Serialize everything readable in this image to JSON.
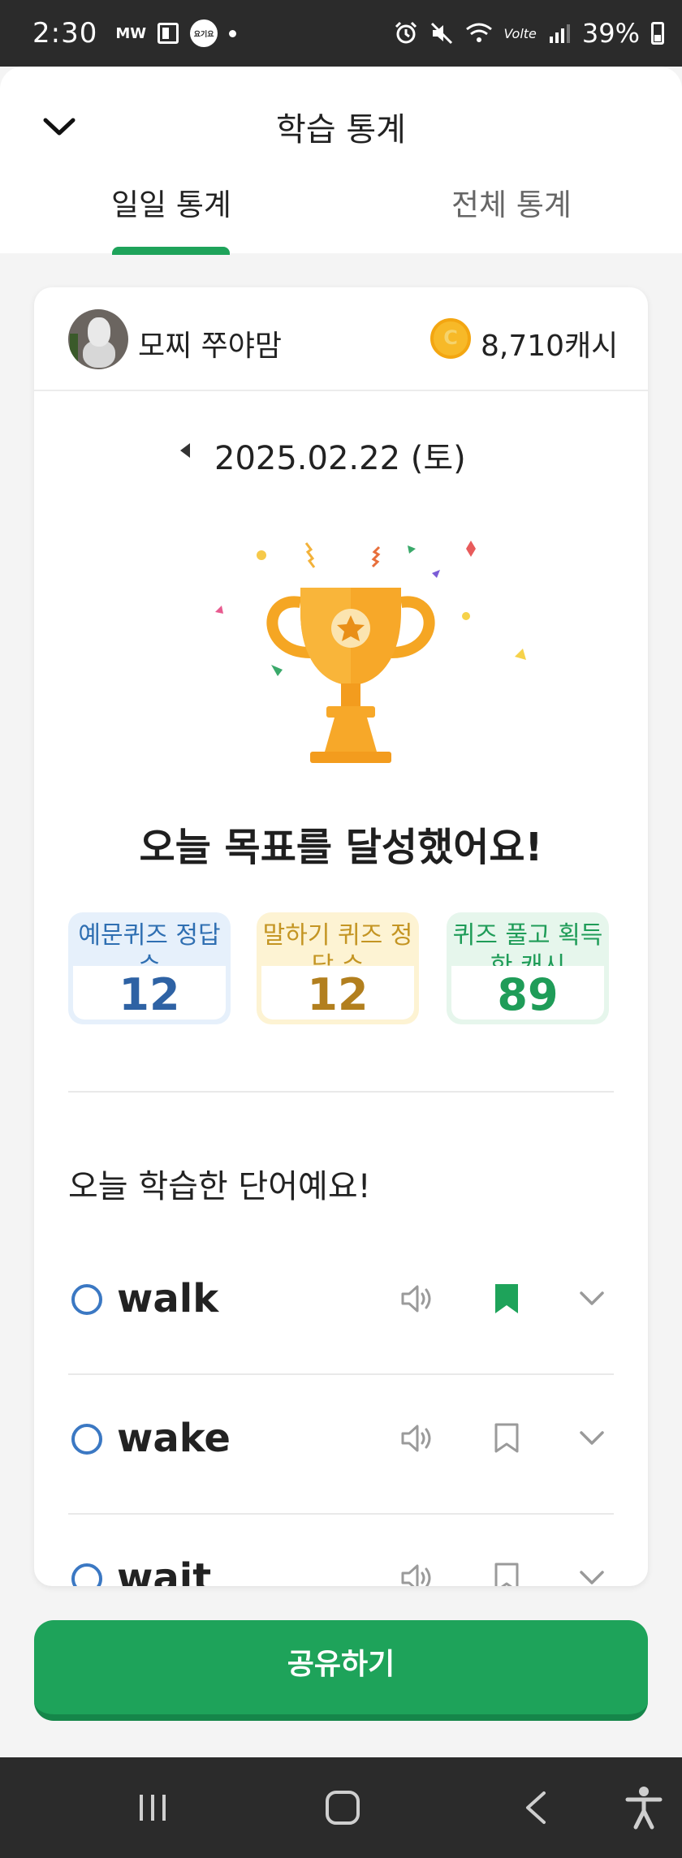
{
  "status_bar": {
    "time": "2:30",
    "mw": "MW",
    "yogiyo": "요기요",
    "volte": "Volte",
    "battery": "39%"
  },
  "header": {
    "title": "학습 통계",
    "tabs": [
      {
        "label": "일일 통계",
        "active": true
      },
      {
        "label": "전체 통계",
        "active": false
      }
    ]
  },
  "profile": {
    "name": "모찌 쭈야맘",
    "cash": "8,710캐시"
  },
  "date": "2025.02.22 (토)",
  "goal_message": "오늘 목표를 달성했어요!",
  "stats": [
    {
      "label": "예문퀴즈 정답 수",
      "value": "12",
      "color": "#2e62a4"
    },
    {
      "label": "말하기 퀴즈 정답 수",
      "value": "12",
      "color": "#b27f1e"
    },
    {
      "label": "퀴즈 풀고 획득한 캐시",
      "value": "89",
      "color": "#1f9c58"
    }
  ],
  "words_title": "오늘 학습한 단어예요!",
  "words": [
    {
      "word": "walk",
      "bookmarked": true
    },
    {
      "word": "wake",
      "bookmarked": false
    },
    {
      "word": "wait",
      "bookmarked": false
    }
  ],
  "share_button": "공유하기",
  "colors": {
    "accent": "#1ea35a",
    "blue": "#3b78c3",
    "trophy": "#f5a623"
  }
}
